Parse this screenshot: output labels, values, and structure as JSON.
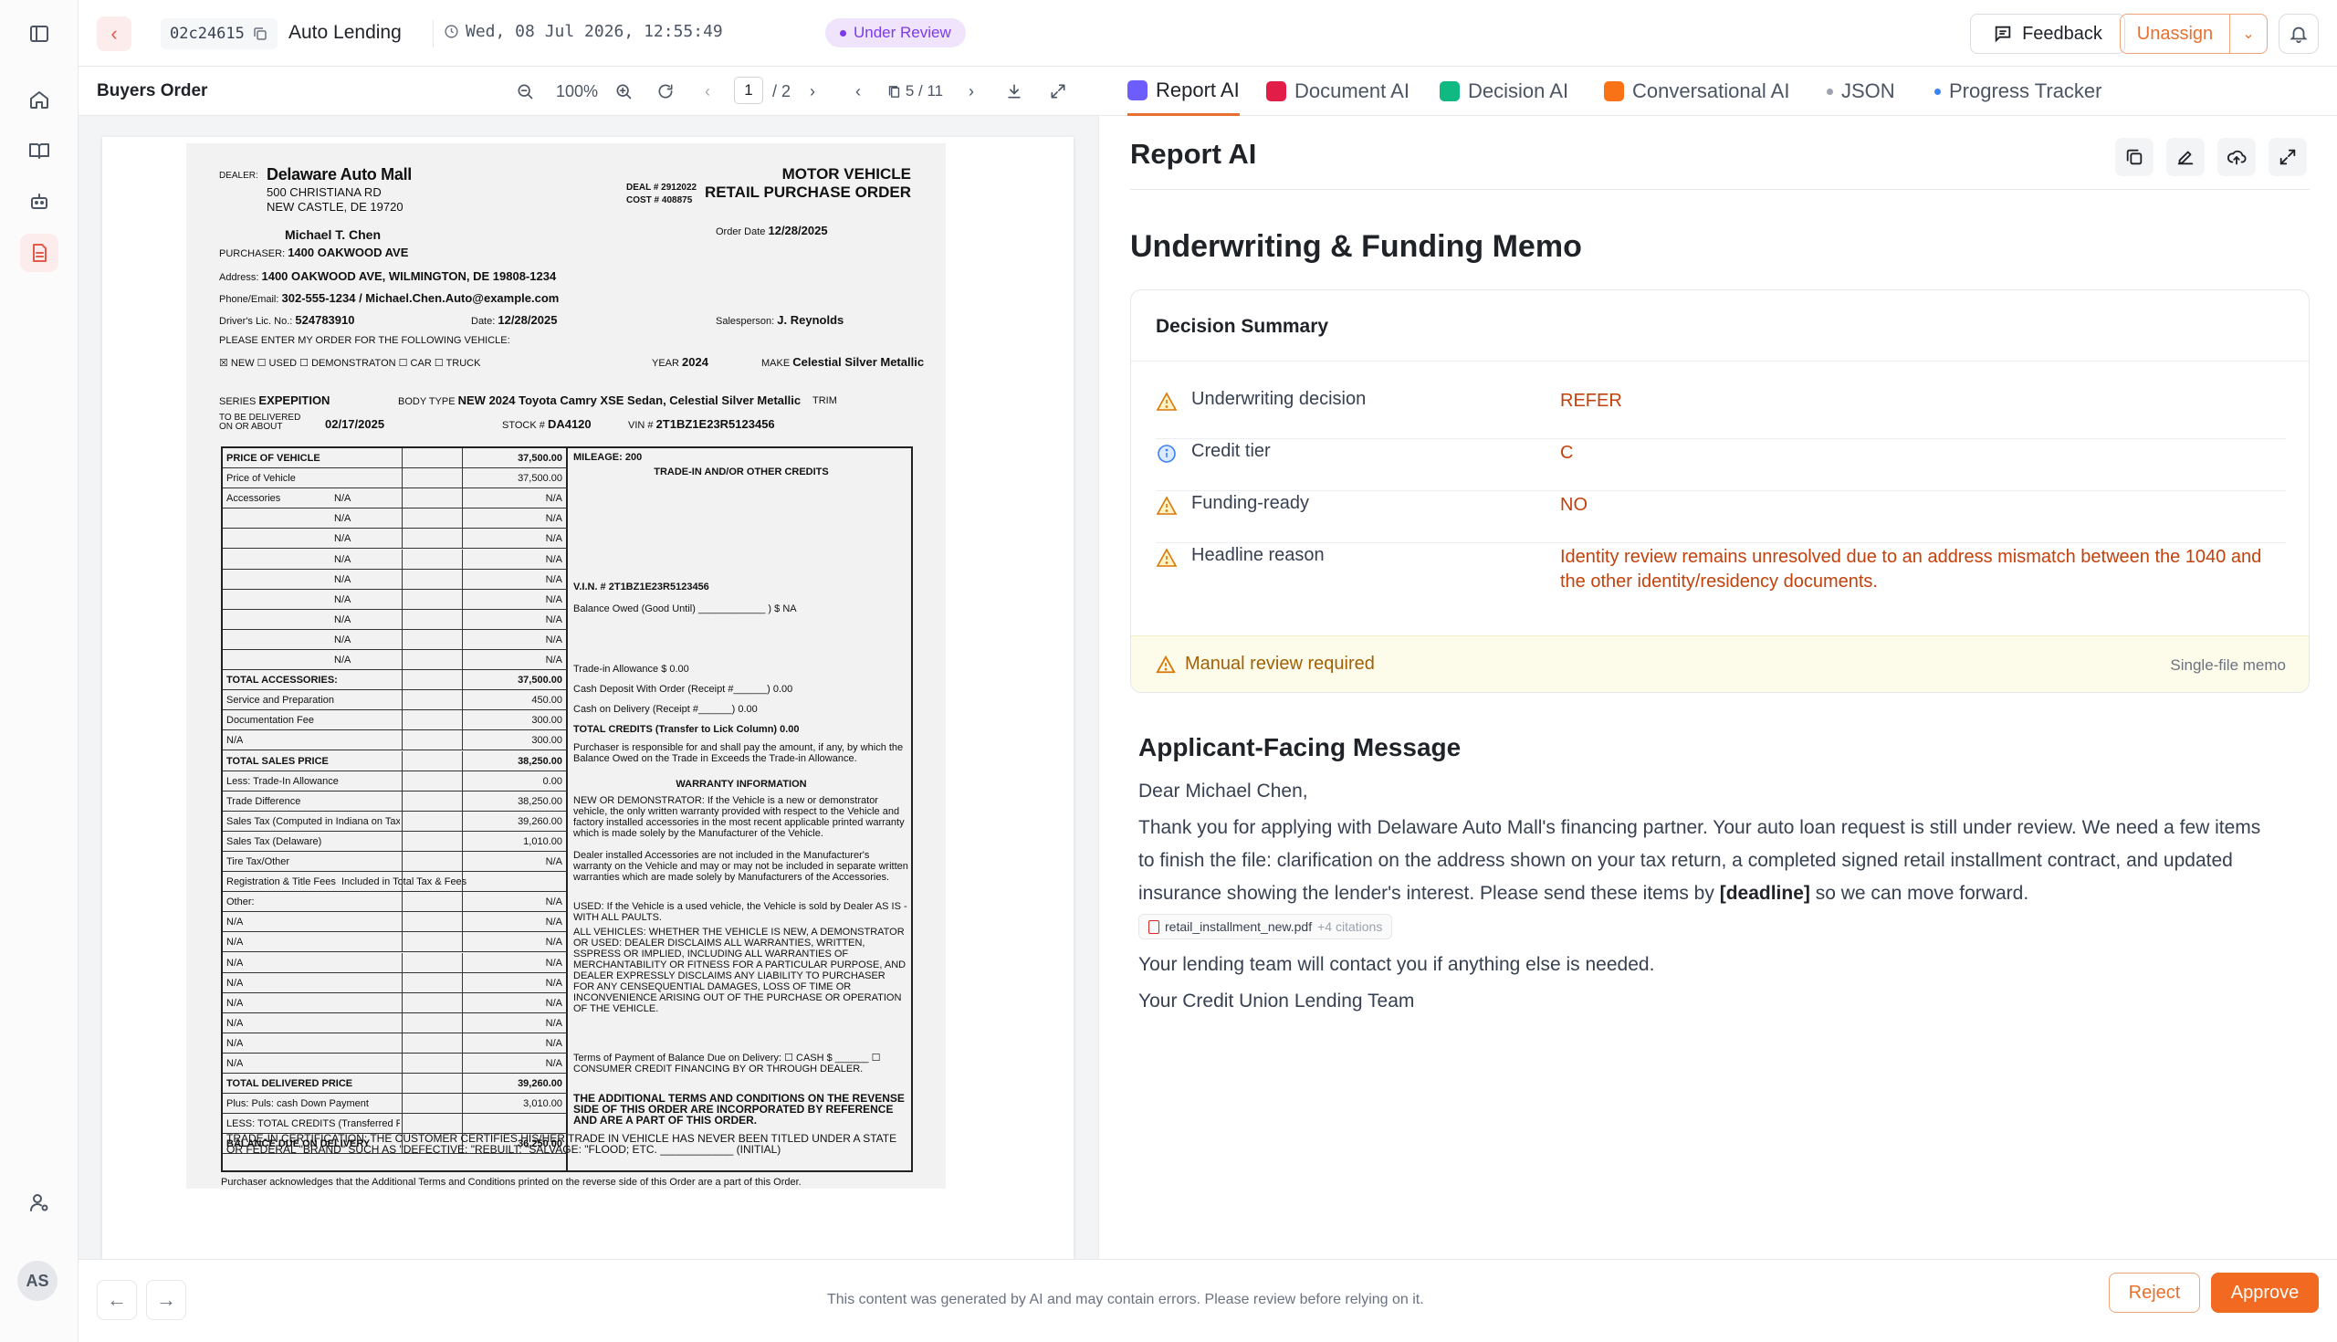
{
  "topbar": {
    "case_id": "02c24615",
    "product": "Auto Lending",
    "datetime": "Wed, 08 Jul 2026, 12:55:49",
    "status": "Under Review",
    "feedback_label": "Feedback",
    "unassign_label": "Unassign"
  },
  "doc": {
    "title": "Buyers Order",
    "zoom": "100%",
    "page_current": "1",
    "page_total": "/ 2",
    "doc_pos": "5 / 11"
  },
  "scan": {
    "dealer_label": "DEALER:",
    "dealer_name": "Delaware Auto Mall",
    "dealer_addr1": "500 CHRISTIANA RD",
    "dealer_addr2": "NEW CASTLE, DE 19720",
    "deal_no": "DEAL # 2912022",
    "cost_no": "COST # 408875",
    "form_title1": "MOTOR VEHICLE",
    "form_title2": "RETAIL PURCHASE ORDER",
    "buyer_name": "Michael T. Chen",
    "purchaser": "PURCHASER:",
    "purchaser_addr": "1400 OAKWOOD AVE",
    "address_lbl": "Address:",
    "address_full": "1400 OAKWOOD AVE, WILMINGTON, DE 19808-1234",
    "phone_lbl": "Phone/Email:",
    "phone": "302-555-1234 / Michael.Chen.Auto@example.com",
    "dl_lbl": "Driver's Lic. No.:",
    "dl": "524783910",
    "date_lbl": "Date:",
    "date": "12/28/2025",
    "order_date_lbl": "Order Date",
    "order_date": "12/28/2025",
    "salesperson_lbl": "Salesperson:",
    "salesperson": "J. Reynolds",
    "enter_order": "PLEASE ENTER MY ORDER FOR THE FOLLOWING VEHICLE:",
    "options": "☒ NEW   ☐ USED   ☐ DEMONSTRATON   ☐ CAR   ☐ TRUCK",
    "year_lbl": "YEAR",
    "year": "2024",
    "make_lbl": "MAKE",
    "make": "Celestial Silver Metallic",
    "series_lbl": "SERIES",
    "series": "EXPEPITION",
    "body_lbl": "BODY TYPE",
    "body": "NEW   2024 Toyota Camry XSE Sedan, Celestial Silver Metallic",
    "trim_lbl": "TRIM",
    "delivered_lbl": "TO BE DELIVERED ON OR ABOUT",
    "delivered": "02/17/2025",
    "stock_lbl": "STOCK #",
    "stock": "DA4120",
    "vin_lbl": "VIN #",
    "vin": "2T1BZ1E23R5123456",
    "rows": [
      {
        "l": "PRICE OF VEHICLE",
        "v": "37,500.00"
      },
      {
        "l": "Price of Vehicle",
        "v": "37,500.00"
      },
      {
        "l": "Accessories",
        "m": "N/A",
        "v": "N/A"
      },
      {
        "l": "",
        "m": "N/A",
        "v": "N/A"
      },
      {
        "l": "",
        "m": "N/A",
        "v": "N/A"
      },
      {
        "l": "",
        "m": "N/A",
        "v": "N/A"
      },
      {
        "l": "",
        "m": "N/A",
        "v": "N/A"
      },
      {
        "l": "",
        "m": "N/A",
        "v": "N/A"
      },
      {
        "l": "",
        "m": "N/A",
        "v": "N/A"
      },
      {
        "l": "",
        "m": "N/A",
        "v": "N/A"
      },
      {
        "l": "",
        "m": "N/A",
        "v": "N/A"
      },
      {
        "l": "TOTAL ACCESSORIES:",
        "v": "37,500.00"
      },
      {
        "l": "Service and Preparation",
        "v": "450.00"
      },
      {
        "l": "Documentation Fee",
        "v": "300.00"
      },
      {
        "l": "N/A",
        "v": "300.00"
      },
      {
        "l": "TOTAL SALES PRICE",
        "v": "38,250.00"
      },
      {
        "l": "Less: Trade-In Allowance",
        "v": "0.00"
      },
      {
        "l": "Trade Difference",
        "v": "38,250.00"
      },
      {
        "l": "Sales Tax (Computed in Indiana on Tax Price)",
        "v": "39,260.00"
      },
      {
        "l": "Sales Tax (Delaware)",
        "v": "1,010.00"
      },
      {
        "l": "Tire Tax/Other",
        "v": "N/A"
      },
      {
        "l": "Registration & Title Fees",
        "m": "Included in Total Tax & Fees",
        "v": ""
      },
      {
        "l": "Other:",
        "v": "N/A"
      },
      {
        "l": "N/A",
        "v": "N/A"
      },
      {
        "l": "N/A",
        "v": "N/A"
      },
      {
        "l": "N/A",
        "v": "N/A"
      },
      {
        "l": "N/A",
        "v": "N/A"
      },
      {
        "l": "N/A",
        "v": "N/A"
      },
      {
        "l": "N/A",
        "v": "N/A"
      },
      {
        "l": "N/A",
        "v": "N/A"
      },
      {
        "l": "N/A",
        "v": "N/A"
      },
      {
        "l": "TOTAL DELIVERED PRICE",
        "v": "39,260.00"
      },
      {
        "l": "Plus: Puls: cash Down Payment",
        "v": "3,010.00"
      },
      {
        "l": "LESS: TOTAL CREDITS (Transferred From Rt. Column)",
        "v": ""
      },
      {
        "l": "BALANCE DUE ON DELIVERY",
        "v": "36,250.00"
      }
    ],
    "mileage": "MILEAGE: 200",
    "trade_hdr": "TRADE-IN AND/OR OTHER CREDITS",
    "vin_trade": "V.I.N. # 2T1BZ1E23R5123456",
    "balance_owed": "Balance Owed (Good Until) ____________ ) $ NA",
    "trade_allow": "Trade-in Allowance   $ 0.00",
    "cash_deposit": "Cash Deposit With Order (Receipt #______)   0.00",
    "cash_delivery": "Cash on Delivery (Receipt #______)   0.00",
    "total_credits": "TOTAL CREDITS (Transfer to Lick Column)   0.00",
    "purchaser_resp": "Purchaser is responsible for and shall pay the amount, if any, by which the Balance Owed on the Trade in Exceeds the Trade-in Allowance.",
    "warranty_hdr": "WARRANTY INFORMATION",
    "warranty_new": "NEW OR DEMONSTRATOR: If the Vehicle is a new or demonstrator vehicle, the only written warranty provided with respect to the Vehicle and factory installed accessories in the most recent applicable printed warranty which is made solely by the Manufacturer of the Vehicle.",
    "warranty_dealer": "Dealer installed Accessories are not included in the Manufacturer's warranty on the Vehicle and may or may not be included in separate written warranties which are made solely by Manufacturers of the Accessories.",
    "warranty_used": "USED: If the Vehicle is a used vehicle, the Vehicle is sold by Dealer AS IS - WITH ALL PAULTS.",
    "warranty_all": "ALL VEHICLES: WHETHER THE VEHICLE IS NEW, A DEMONSTRATOR OR USED: DEALER DISCLAIMS ALL WARRANTIES, WRITTEN, SSPRESS OR IMPLIED, INCLUDING ALL WARRANTIES OF MERCHANTABILITY OR FITNESS FOR A PARTICULAR PURPOSE, AND DEALER EXPRESSLY DISCLAIMS ANY LIABILITY TO PURCHASER FOR ANY CENSEQUENTIAL DAMAGES, LOSS OF TIME OR INCONVENIENCE ARISING OUT OF THE PURCHASE OR OPERATION OF THE VEHICLE.",
    "terms": "Terms of Payment of Balance Due on Delivery: ☐ CASH $ ______  ☐ CONSUMER CREDIT FINANCING BY OR THROUGH DEALER.",
    "additional": "THE ADDITIONAL TERMS AND CONDITIONS ON THE REVENSE SIDE OF THIS ORDER ARE INCORPORATED BY REFERENCE AND ARE A PART OF THIS ORDER.",
    "cert": "TRADE-IN CERTIFICATION: THE CUSTOMER CERTIFIES HIS/HER TRADE IN VEHICLE HAS NEVER BEEN TITLED UNDER A STATE OR FEDERAL \"BRAND\" SUCH AS \"DEFECTIVE: \"REBUILT: \"SALVAGE: \"FLOOD; ETC. ____________ (INITIAL)",
    "ack": "Purchaser acknowledges that the Additional Terms and Conditions printed on the reverse side of this Order are a part of this Order."
  },
  "tabs": [
    {
      "label": "Report AI",
      "color": "#6d5dfc"
    },
    {
      "label": "Document AI",
      "color": "#e11d48"
    },
    {
      "label": "Decision AI",
      "color": "#10b981"
    },
    {
      "label": "Conversational AI",
      "color": "#f97316"
    },
    {
      "label": "JSON",
      "color": "#9ca3af"
    },
    {
      "label": "Progress Tracker",
      "color": "#3b82f6"
    }
  ],
  "report": {
    "title": "Report AI",
    "memo_title": "Underwriting & Funding Memo",
    "summary_title": "Decision Summary",
    "rows": [
      {
        "label": "Underwriting decision",
        "value": "REFER",
        "icon": "warning-icon"
      },
      {
        "label": "Credit tier",
        "value": "C",
        "icon": "info-icon"
      },
      {
        "label": "Funding-ready",
        "value": "NO",
        "icon": "warning-icon"
      },
      {
        "label": "Headline reason",
        "value": "Identity review remains unresolved due to an address mismatch between the 1040 and the other identity/residency documents.",
        "icon": "warning-icon"
      }
    ],
    "manual_review": "Manual review required",
    "single_file": "Single-file memo",
    "applicant_title": "Applicant-Facing Message",
    "greeting": "Dear Michael Chen,",
    "body_a": "Thank you for applying with Delaware Auto Mall's financing partner. Your auto loan request is still under review. We need a few items to finish the file: clarification on the address shown on your tax return, a completed signed retail installment contract, and updated insurance showing the lender's interest. Please send these items by ",
    "body_deadline": "[deadline]",
    "body_b": " so we can move forward.",
    "cite_file": "retail_installment_new.pdf",
    "cite_more": "+4 citations",
    "contact": "Your lending team will contact you if anything else is needed.",
    "signoff": "Your Credit Union Lending Team"
  },
  "footer": {
    "disclaimer": "This content was generated by AI and may contain errors. Please review before relying on it.",
    "reject": "Reject",
    "approve": "Approve"
  },
  "user": {
    "initials": "AS"
  },
  "colors": {
    "accent": "#f26a21",
    "status": "#7c3aed",
    "warning": "#c2410c"
  }
}
